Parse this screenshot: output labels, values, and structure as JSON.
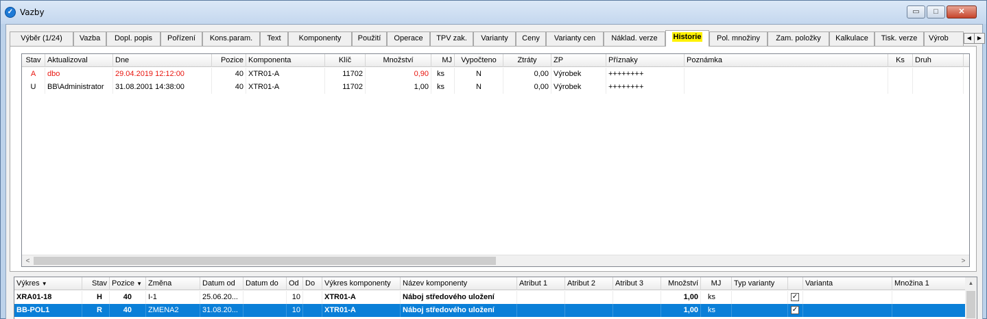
{
  "window": {
    "title": "Vazby",
    "app_icon": "app-logo-icon",
    "buttons": {
      "minimize": "▭",
      "maximize": "□",
      "close": "✕"
    }
  },
  "tabs": [
    {
      "label": "Výběr (1/24)"
    },
    {
      "label": "Vazba"
    },
    {
      "label": "Dopl. popis"
    },
    {
      "label": "Pořízení"
    },
    {
      "label": "Kons.param."
    },
    {
      "label": "Text"
    },
    {
      "label": "Komponenty"
    },
    {
      "label": "Použití"
    },
    {
      "label": "Operace"
    },
    {
      "label": "TPV zak."
    },
    {
      "label": "Varianty"
    },
    {
      "label": "Ceny"
    },
    {
      "label": "Varianty cen"
    },
    {
      "label": "Náklad. verze"
    },
    {
      "label": "Historie"
    },
    {
      "label": "Pol. množiny"
    },
    {
      "label": "Zam. položky"
    },
    {
      "label": "Kalkulace"
    },
    {
      "label": "Tisk. verze"
    },
    {
      "label": "Výrob"
    }
  ],
  "active_tab": "Historie",
  "history_grid": {
    "columns": [
      "Stav",
      "Aktualizoval",
      "Dne",
      "Pozice",
      "Komponenta",
      "Klíč",
      "Množství",
      "MJ",
      "Vypočteno",
      "Ztráty",
      "ZP",
      "Příznaky",
      "Poznámka",
      "Ks",
      "Druh"
    ],
    "rows": [
      {
        "stav": "A",
        "aktualizoval": "dbo",
        "dne": "29.04.2019 12:12:00",
        "pozice": "40",
        "komponenta": "XTR01-A",
        "klic": "11702",
        "mnozstvi": "0,90",
        "mj": "ks",
        "vypocteno": "N",
        "ztraty": "0,00",
        "zp": "Výrobek",
        "priznaky": "++++++++",
        "poznamka": "",
        "ks": "",
        "druh": ""
      },
      {
        "stav": "U",
        "aktualizoval": "BB\\Administrator",
        "dne": "31.08.2001 14:38:00",
        "pozice": "40",
        "komponenta": "XTR01-A",
        "klic": "11702",
        "mnozstvi": "1,00",
        "mj": "ks",
        "vypocteno": "N",
        "ztraty": "0,00",
        "zp": "Výrobek",
        "priznaky": "++++++++",
        "poznamka": "",
        "ks": "",
        "druh": ""
      }
    ],
    "scroll_left": "<",
    "scroll_right": ">"
  },
  "bottom_grid": {
    "columns": [
      "Výkres",
      "Stav",
      "Pozice",
      "Změna",
      "Datum od",
      "Datum do",
      "Od",
      "Do",
      "Výkres komponenty",
      "Název komponenty",
      "Atribut 1",
      "Atribut 2",
      "Atribut 3",
      "Množství",
      "MJ",
      "Typ varianty",
      "",
      "Varianta",
      "Množina 1"
    ],
    "sort_indicator": "▼",
    "rows": [
      {
        "vykres": "XRA01-18",
        "stav": "H",
        "pozice": "40",
        "zmena": "I-1",
        "datum_od": "25.06.20...",
        "datum_do": "",
        "od": "10",
        "do": "",
        "vykres_komponenty": "XTR01-A",
        "nazev": "Náboj středového uložení",
        "atr1": "",
        "atr2": "",
        "atr3": "",
        "mnozstvi": "1,00",
        "mj": "ks",
        "typ_varianty": "",
        "check": "✓",
        "varianta": "",
        "mnozina": "",
        "selected": false
      },
      {
        "vykres": "BB-POL1",
        "stav": "R",
        "pozice": "40",
        "zmena": "ZMENA2",
        "datum_od": "31.08.20...",
        "datum_do": "",
        "od": "10",
        "do": "",
        "vykres_komponenty": "XTR01-A",
        "nazev": "Náboj středového uložení",
        "atr1": "",
        "atr2": "",
        "atr3": "",
        "mnozstvi": "1,00",
        "mj": "ks",
        "typ_varianty": "",
        "check": "✓",
        "varianta": "",
        "mnozina": "",
        "selected": true
      }
    ],
    "scroll_up": "▲"
  },
  "colors": {
    "highlight_tab": "#fff200",
    "selection": "#0a7fd8",
    "status_red": "#e8150e"
  }
}
